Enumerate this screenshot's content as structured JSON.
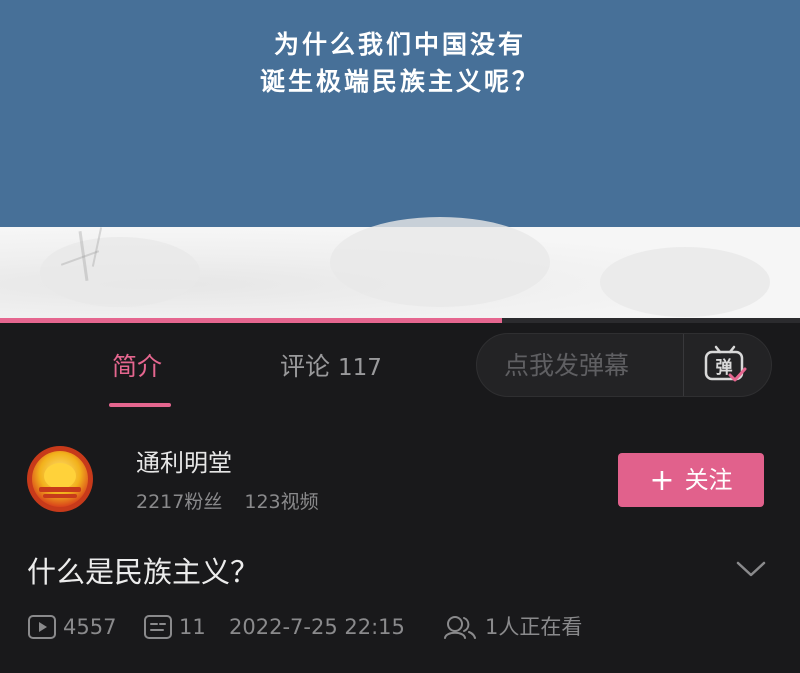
{
  "video": {
    "caption_line1": "为什么我们中国没有",
    "caption_line2": "诞生极端民族主义呢？",
    "progress_fraction": 0.628,
    "colors": {
      "top": "#477098",
      "accent": "#e5668f"
    }
  },
  "tabs": {
    "intro_label": "简介",
    "comments_label": "评论",
    "comments_count": "117"
  },
  "danmaku": {
    "placeholder": "点我发弹幕",
    "button_glyph": "弹"
  },
  "uploader": {
    "name": "通利明堂",
    "fans": "2217粉丝",
    "videos": "123视频",
    "follow_label": "关注",
    "follow_plus": "+"
  },
  "video_info": {
    "title": "什么是民族主义？",
    "plays": "4557",
    "danmaku_count": "11",
    "date": "2022-7-25 22:15",
    "watching": "1人正在看"
  },
  "icons": [
    "play-count-icon",
    "danmaku-count-icon",
    "watching-icon",
    "chevron-down-icon",
    "danmaku-tv-icon"
  ]
}
